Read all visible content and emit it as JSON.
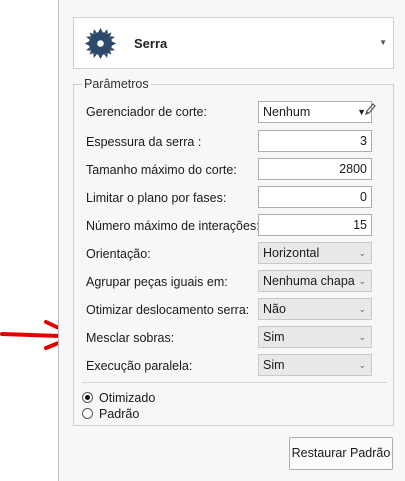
{
  "header": {
    "title": "Serra",
    "icon": "saw-blade-icon"
  },
  "group": {
    "legend": "Parâmetros"
  },
  "fields": {
    "gerenciador": {
      "label": "Gerenciador de corte:",
      "value": "Nenhum"
    },
    "espessura": {
      "label": "Espessura da serra :",
      "value": "3"
    },
    "tamanho": {
      "label": "Tamanho máximo do corte:",
      "value": "2800"
    },
    "limitar": {
      "label": "Limitar o plano por fases:",
      "value": "0"
    },
    "numero": {
      "label": "Número máximo de interações:",
      "value": "15"
    },
    "orientacao": {
      "label": "Orientação:",
      "value": "Horizontal"
    },
    "agrupar": {
      "label": "Agrupar peças iguais em:",
      "value": "Nenhuma chapa"
    },
    "otimizar": {
      "label": "Otimizar deslocamento serra:",
      "value": "Não"
    },
    "mesclar": {
      "label": "Mesclar sobras:",
      "value": "Sim"
    },
    "execucao": {
      "label": "Execução paralela:",
      "value": "Sim"
    }
  },
  "radios": {
    "otimizado": "Otimizado",
    "padrao": "Padrão",
    "selected": "Otimizado"
  },
  "buttons": {
    "restaurar": "Restaurar Padrão"
  },
  "colors": {
    "arrow": "#e30000",
    "panel_bg": "#f7f7f7"
  }
}
